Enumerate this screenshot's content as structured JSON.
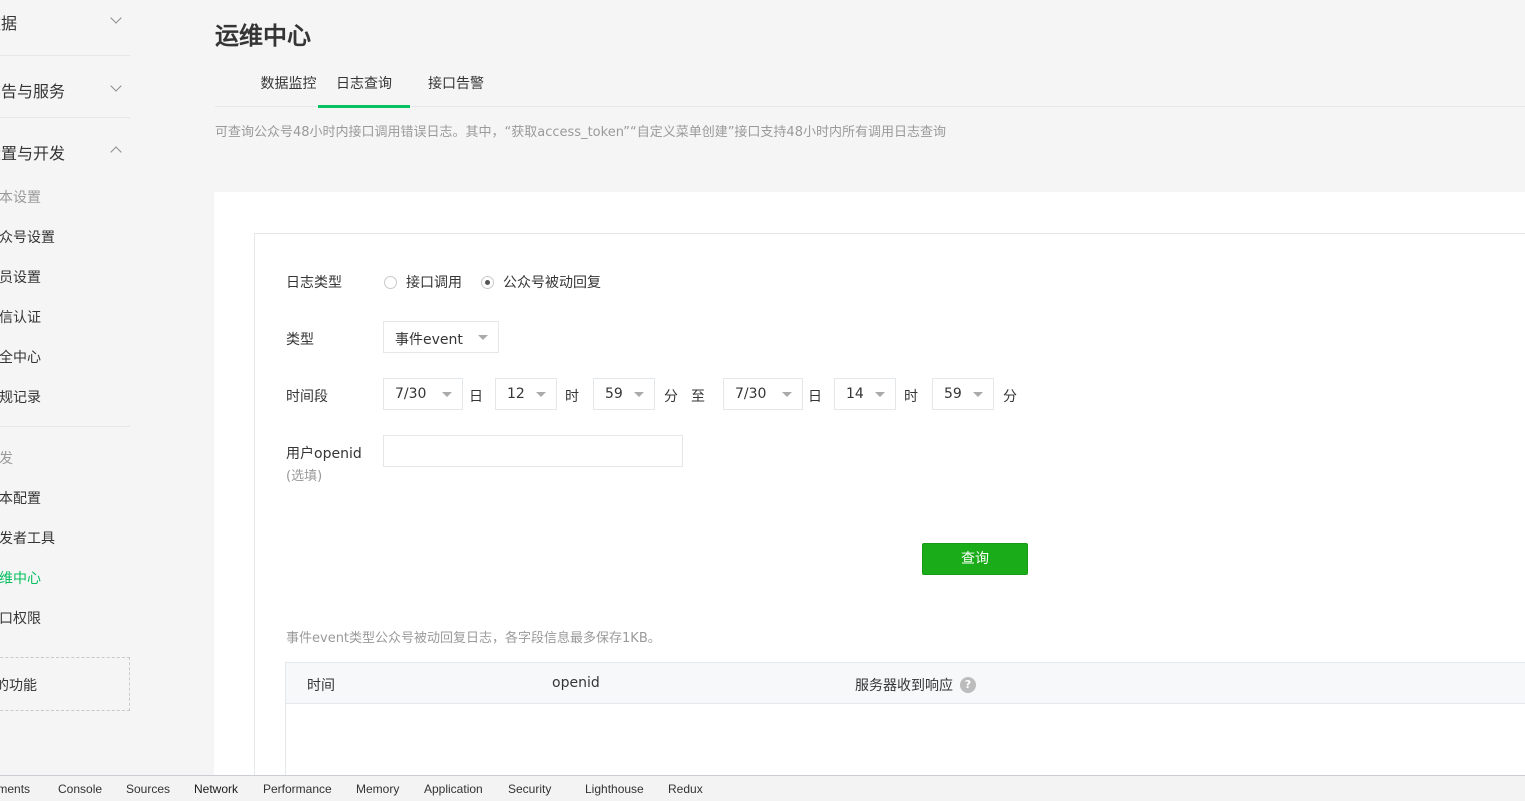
{
  "sidebar": {
    "groups": [
      {
        "label": "数据",
        "state": "collapsed"
      },
      {
        "label": "广告与服务",
        "state": "collapsed"
      },
      {
        "label": "设置与开发",
        "state": "expanded"
      }
    ],
    "settings_category": "基本设置",
    "settings_items": [
      "公众号设置",
      "人员设置",
      "微信认证",
      "安全中心",
      "违规记录"
    ],
    "dev_category": "开发",
    "dev_items": [
      "基本配置",
      "开发者工具",
      "运维中心",
      "接口权限"
    ],
    "active_item": "运维中心",
    "new_feature": "新的功能"
  },
  "header": {
    "title": "运维中心",
    "tabs": [
      "数据监控",
      "日志查询",
      "接口告警"
    ],
    "active_tab": "日志查询",
    "description": "可查询公众号48小时内接口调用错误日志。其中，“获取access_token”“自定义菜单创建”接口支持48小时内所有调用日志查询"
  },
  "form": {
    "log_type_label": "日志类型",
    "log_type_options": [
      "接口调用",
      "公众号被动回复"
    ],
    "log_type_selected": "公众号被动回复",
    "type_label": "类型",
    "type_value": "事件event",
    "period_label": "时间段",
    "start": {
      "date": "7/30",
      "hour": "12",
      "minute": "59"
    },
    "end": {
      "date": "7/30",
      "hour": "14",
      "minute": "59"
    },
    "unit_day": "日",
    "unit_hour": "时",
    "unit_minute": "分",
    "to": "至",
    "openid_label": "用户openid",
    "openid_optional": "(选填)",
    "openid_value": "",
    "openid_placeholder": "",
    "query_button": "查询"
  },
  "results": {
    "note": "事件event类型公众号被动回复日志，各字段信息最多保存1KB。",
    "columns": [
      "时间",
      "openid",
      "服务器收到响应"
    ],
    "help_icon": "?",
    "rows": []
  },
  "devtools": {
    "tabs": [
      "Elements",
      "Console",
      "Sources",
      "Network",
      "Performance",
      "Memory",
      "Application",
      "Security",
      "Lighthouse",
      "Redux"
    ],
    "active_tab": "Network"
  },
  "colors": {
    "accent": "#07c160",
    "button": "#1aad19",
    "muted_text": "#9a9a9a",
    "border": "#e4e8eb"
  }
}
